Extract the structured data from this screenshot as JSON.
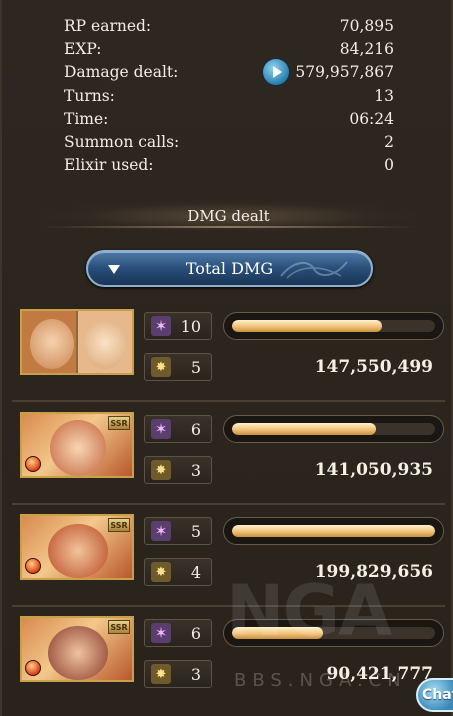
{
  "stats": [
    {
      "label": "RP earned:",
      "value": "70,895"
    },
    {
      "label": "EXP:",
      "value": "84,216"
    },
    {
      "label": "Damage dealt:",
      "value": "579,957,867"
    },
    {
      "label": "Turns:",
      "value": "13"
    },
    {
      "label": "Time:",
      "value": "06:24"
    },
    {
      "label": "Summon calls:",
      "value": "2"
    },
    {
      "label": "Elixir used:",
      "value": "0"
    }
  ],
  "section_title": "DMG dealt",
  "total_dmg_label": "Total DMG",
  "characters": [
    {
      "portrait": "dual-portrait",
      "skills": "10",
      "charge_attacks": "5",
      "damage": "147,550,499",
      "damage_fraction": 0.74
    },
    {
      "portrait": "ssr-fire-portrait",
      "skills": "6",
      "charge_attacks": "3",
      "damage": "141,050,935",
      "damage_fraction": 0.71
    },
    {
      "portrait": "ssr-fire-portrait",
      "skills": "5",
      "charge_attacks": "4",
      "damage": "199,829,656",
      "damage_fraction": 1.0
    },
    {
      "portrait": "ssr-fire-portrait",
      "skills": "6",
      "charge_attacks": "3",
      "damage": "90,421,777",
      "damage_fraction": 0.45
    }
  ],
  "ssr_label": "SSR",
  "watermark": {
    "logo": "NGA",
    "url": "BBS.NGA.CN"
  },
  "chat_label": "Chat",
  "colors": {
    "background": "#2b241d",
    "bar_fill": "#f0c27a",
    "button_blue": "#284e78"
  }
}
